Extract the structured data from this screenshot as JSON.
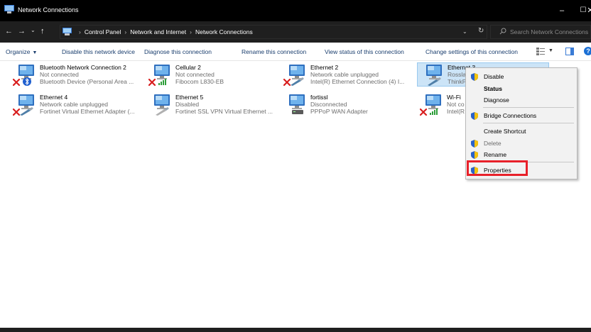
{
  "window": {
    "title": "Network Connections",
    "minimize_glyph": "–",
    "maximize_glyph": "☐",
    "close_glyph": "✕"
  },
  "address": {
    "back_glyph": "←",
    "forward_glyph": "→",
    "recent_glyph": "⌄",
    "up_glyph": "↑",
    "breadcrumb": [
      "Control Panel",
      "Network and Internet",
      "Network Connections"
    ],
    "crumb_separator": "›",
    "dropdown_glyph": "⌄",
    "refresh_glyph": "↻",
    "search_placeholder": "Search Network Connections"
  },
  "commands": {
    "organize": "Organize",
    "disable": "Disable this network device",
    "diagnose": "Diagnose this connection",
    "rename": "Rename this connection",
    "view_status": "View status of this connection",
    "change_settings": "Change settings of this connection",
    "dropdown_glyph": "▼",
    "help_glyph": "?"
  },
  "connections": [
    {
      "name": "Bluetooth Network Connection 2",
      "status": "Not connected",
      "device": "Bluetooth Device (Personal Area ...",
      "overlay": "red-x",
      "badge": "bluetooth"
    },
    {
      "name": "Cellular 2",
      "status": "Not connected",
      "device": "Fibocom L830-EB",
      "overlay": "red-x",
      "badge": "signal"
    },
    {
      "name": "Ethernet 2",
      "status": "Network cable unplugged",
      "device": "Intel(R) Ethernet Connection (4) I...",
      "overlay": "red-x",
      "badge": "cable"
    },
    {
      "name": "Ethernet 3",
      "status": "Rossla",
      "device": "ThinkP",
      "overlay": "none",
      "badge": "cable",
      "selected": true
    },
    {
      "name": "Ethernet 4",
      "status": "Network cable unplugged",
      "device": "Fortinet Virtual Ethernet Adapter (...",
      "overlay": "red-x",
      "badge": "cable"
    },
    {
      "name": "Ethernet 5",
      "status": "Disabled",
      "device": "Fortinet SSL VPN Virtual Ethernet ...",
      "overlay": "none",
      "badge": "cable-gray"
    },
    {
      "name": "fortissl",
      "status": "Disconnected",
      "device": "PPPoP WAN Adapter",
      "overlay": "none",
      "badge": "modem"
    },
    {
      "name": "Wi-Fi",
      "status": "Not co",
      "device": "Intel(R",
      "overlay": "red-x",
      "badge": "signal"
    }
  ],
  "context_menu": {
    "items": [
      {
        "label": "Disable",
        "shield": true,
        "style": "normal"
      },
      {
        "label": "Status",
        "shield": false,
        "style": "bold"
      },
      {
        "label": "Diagnose",
        "shield": false,
        "style": "normal"
      },
      {
        "label": "Bridge Connections",
        "shield": true,
        "style": "normal"
      },
      {
        "label": "Create Shortcut",
        "shield": false,
        "style": "normal"
      },
      {
        "label": "Delete",
        "shield": true,
        "style": "disabled"
      },
      {
        "label": "Rename",
        "shield": true,
        "style": "normal"
      },
      {
        "label": "Properties",
        "shield": true,
        "style": "normal",
        "highlighted": true
      }
    ]
  },
  "colors": {
    "titlebar": "#000000",
    "addressbar": "#1f1f1f",
    "selection": "#cce4f7",
    "highlight_border": "#e8212a",
    "command_text": "#1a3e6e"
  }
}
